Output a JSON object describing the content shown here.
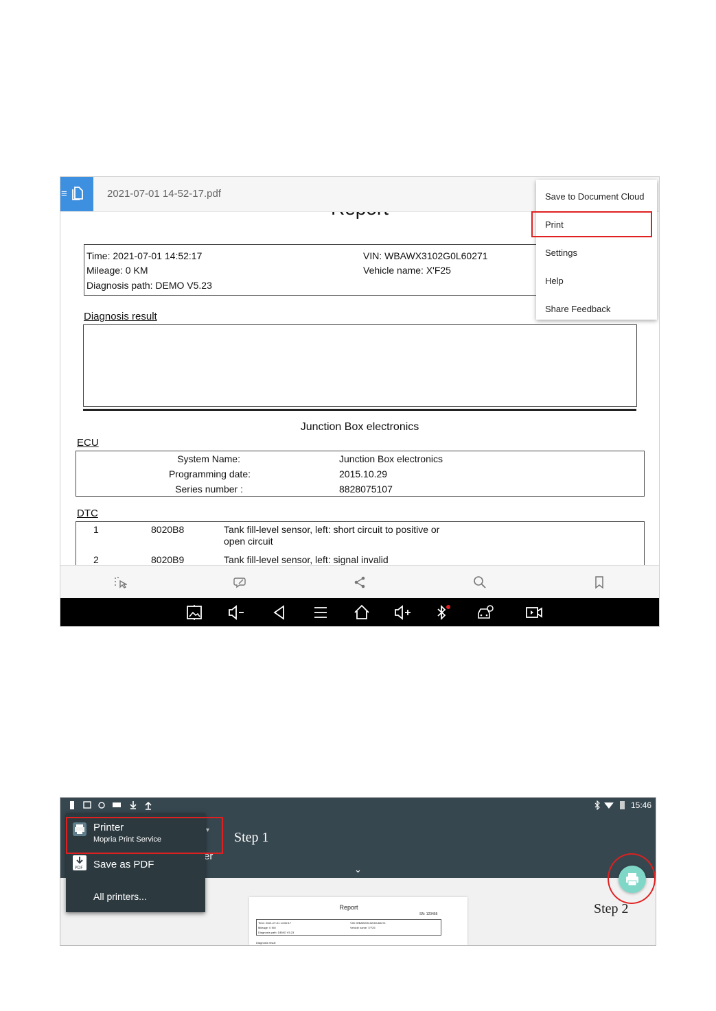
{
  "screenshot1": {
    "header": {
      "filename": "2021-07-01 14-52-17.pdf"
    },
    "report": {
      "heading": "Report",
      "info": {
        "time": "Time: 2021-07-01 14:52:17",
        "mileage": "Mileage: 0 KM",
        "diagnosis_path": "Diagnosis path: DEMO V5.23",
        "vin": "VIN: WBAWX3102G0L60271",
        "vehicle_name": "Vehicle name: X'F25"
      },
      "diagnosis_result_label": "Diagnosis result",
      "section_title": "Junction Box electronics",
      "ecu_label": "ECU",
      "ecu_rows": [
        {
          "label": "System Name:",
          "value": "Junction Box electronics"
        },
        {
          "label": "Programming date:",
          "value": "2015.10.29"
        },
        {
          "label": "Series number :",
          "value": "8828075107"
        }
      ],
      "dtc_label": "DTC",
      "dtc_rows": [
        {
          "index": "1",
          "code": "8020B8",
          "desc1": "Tank fill-level sensor, left: short circuit to positive or",
          "desc2": "open circuit"
        },
        {
          "index": "2",
          "code": "8020B9",
          "desc1": "Tank fill-level sensor, left: signal invalid",
          "desc2": ""
        }
      ]
    },
    "menu": {
      "items": [
        "Save to Document Cloud",
        "Print",
        "Settings",
        "Help",
        "Share Feedback"
      ],
      "highlighted": "Print",
      "highlight_color": "#e02020"
    },
    "toolbar_icons": [
      "select-icon",
      "comment-icon",
      "share-icon",
      "search-icon",
      "bookmark-icon"
    ],
    "nav_icons": [
      "screenshot-icon",
      "volume-down-icon",
      "back-icon",
      "menu-icon",
      "home-icon",
      "volume-up-icon",
      "bluetooth-icon",
      "car-diagnostics-icon",
      "screen-record-icon"
    ]
  },
  "screenshot2": {
    "status": {
      "time": "15:46"
    },
    "step1": "Step 1",
    "step2": "Step 2",
    "appbar_partial": "er",
    "dropdown": {
      "printer_title": "Printer",
      "printer_sub": "Mopria Print Service",
      "save_pdf": "Save as PDF",
      "all_printers": "All printers..."
    },
    "preview": {
      "title": "Report",
      "sn": "SN: 123456",
      "time": "Time: 2021-07-01 14:52:17",
      "mileage": "Mileage: 0 KM",
      "path": "Diagnosis path: DEMO V5.23",
      "vin": "VIN: WBAWX3102G0L60271",
      "vehicle": "Vehicle name: X'F25",
      "diag": "Diagnosis result"
    },
    "accent": "#7fd7c8",
    "appbar_color": "#37474f"
  }
}
